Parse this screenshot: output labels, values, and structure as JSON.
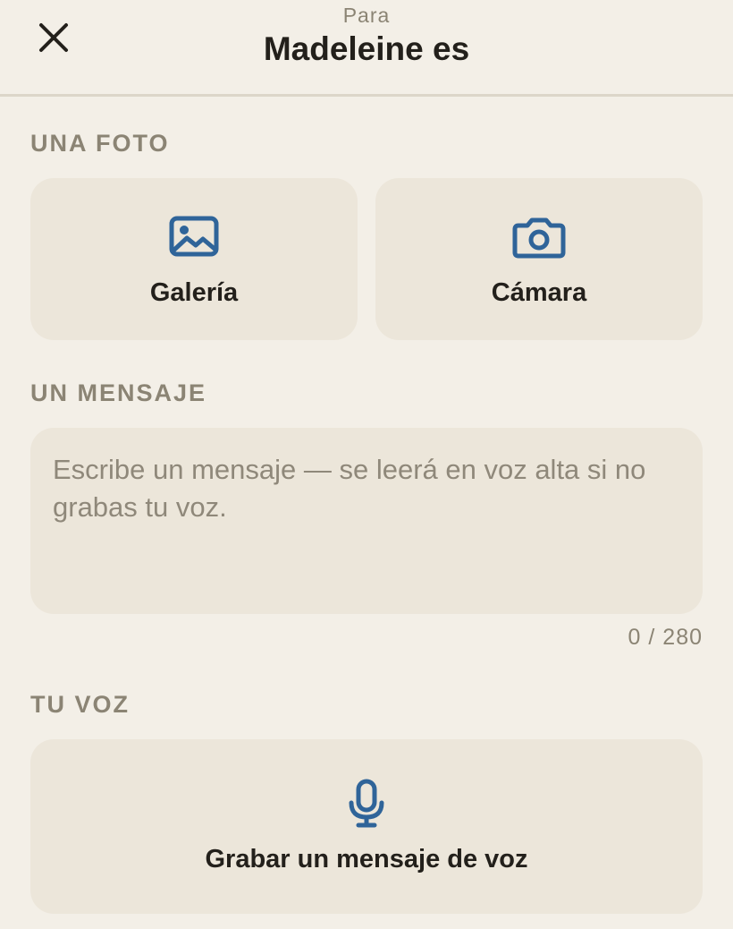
{
  "header": {
    "eyebrow": "Para",
    "title": "Madeleine es",
    "close_icon": "close-icon"
  },
  "photo_section": {
    "label": "UNA FOTO",
    "gallery": {
      "label": "Galería",
      "icon": "image-icon"
    },
    "camera": {
      "label": "Cámara",
      "icon": "camera-icon"
    }
  },
  "message_section": {
    "label": "UN MENSAJE",
    "value": "",
    "placeholder": "Escribe un mensaje — se leerá en voz alta si no grabas tu voz.",
    "counter": "0 / 280"
  },
  "voice_section": {
    "label": "TU VOZ",
    "record": {
      "label": "Grabar un mensaje de voz",
      "icon": "microphone-icon"
    }
  },
  "colors": {
    "background": "#f3efe7",
    "card": "#ece6da",
    "accent_icon": "#2f6499",
    "muted_text": "#8b8474",
    "primary_text": "#23201b"
  }
}
